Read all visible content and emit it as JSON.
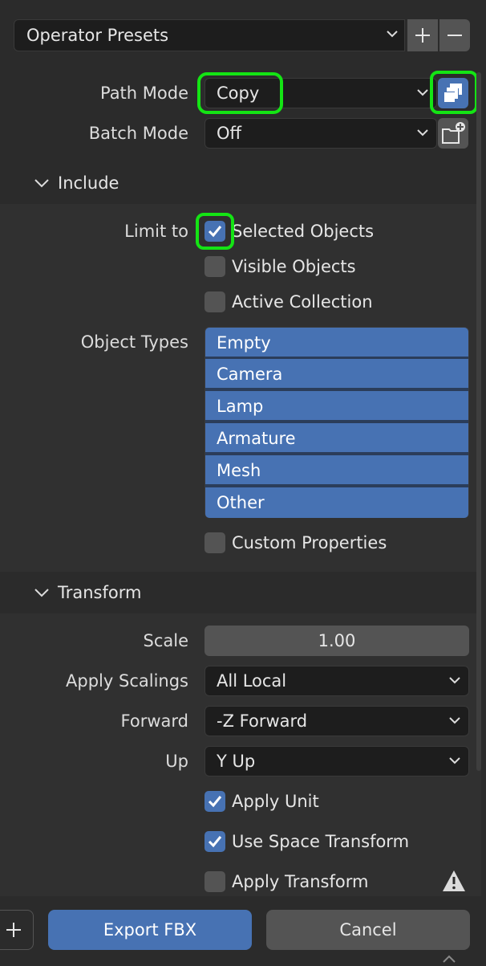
{
  "presets": {
    "label": "Operator Presets",
    "add_icon": "plus-icon",
    "remove_icon": "minus-icon"
  },
  "path_mode": {
    "label": "Path Mode",
    "value": "Copy",
    "icon": "embed-textures-icon"
  },
  "batch_mode": {
    "label": "Batch Mode",
    "value": "Off",
    "icon": "new-folder-icon"
  },
  "include": {
    "title": "Include",
    "limit_to_label": "Limit to",
    "selected_objects": {
      "label": "Selected Objects",
      "checked": true
    },
    "visible_objects": {
      "label": "Visible Objects",
      "checked": false
    },
    "active_collection": {
      "label": "Active Collection",
      "checked": false
    },
    "object_types_label": "Object Types",
    "object_types": [
      "Empty",
      "Camera",
      "Lamp",
      "Armature",
      "Mesh",
      "Other"
    ],
    "custom_properties": {
      "label": "Custom Properties",
      "checked": false
    }
  },
  "transform": {
    "title": "Transform",
    "scale_label": "Scale",
    "scale_value": "1.00",
    "apply_scalings_label": "Apply Scalings",
    "apply_scalings_value": "All Local",
    "forward_label": "Forward",
    "forward_value": "-Z Forward",
    "up_label": "Up",
    "up_value": "Y Up",
    "apply_unit": {
      "label": "Apply Unit",
      "checked": true
    },
    "use_space_transform": {
      "label": "Use Space Transform",
      "checked": true
    },
    "apply_transform": {
      "label": "Apply Transform",
      "checked": false
    },
    "warning_icon": "warning-icon"
  },
  "footer": {
    "add_icon": "plus-icon",
    "export_label": "Export FBX",
    "cancel_label": "Cancel"
  },
  "colors": {
    "accent": "#4772b3",
    "highlight": "#14e414",
    "background": "#2b2b2b"
  }
}
